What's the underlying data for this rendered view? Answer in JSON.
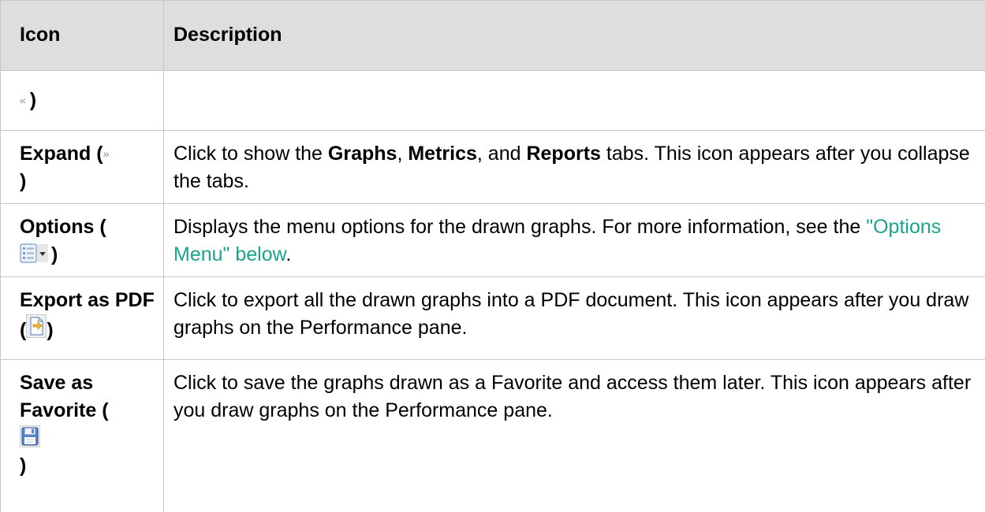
{
  "table": {
    "headers": {
      "icon": "Icon",
      "description": "Description"
    },
    "rows": {
      "collapse": {
        "icon_suffix": ")"
      },
      "expand": {
        "name": "Expand (",
        "icon_suffix": ")",
        "desc_1": "Click to show the ",
        "graphs": "Graphs",
        "comma_1": ", ",
        "metrics": "Metrics",
        "comma_2": ", and ",
        "reports": "Reports",
        "desc_2": " tabs. This icon appears after you collapse the tabs."
      },
      "options": {
        "name": "Options (",
        "icon_suffix": ")",
        "desc_1": "Displays the menu options for the drawn graphs. For more information, see the ",
        "link": "\"Options Menu\" below",
        "desc_2": "."
      },
      "export": {
        "name": "Export as PDF (",
        "icon_suffix": ")",
        "desc": "Click to export all the drawn graphs into a PDF document. This icon appears after you draw graphs on the Performance pane."
      },
      "favorite": {
        "name": "Save as Favorite (",
        "icon_suffix": ")",
        "desc": "Click to save the graphs drawn as a Favorite and access them later. This icon appears after you draw graphs on the Performance pane."
      }
    }
  },
  "icons": {
    "collapse": "double-chevron-left-icon",
    "expand": "double-chevron-right-icon",
    "options": "options-menu-icon",
    "export": "export-pdf-icon",
    "favorite": "save-floppy-icon"
  },
  "colors": {
    "header_bg": "#dedede",
    "border": "#c6c6c6",
    "link": "#1aa58b"
  }
}
